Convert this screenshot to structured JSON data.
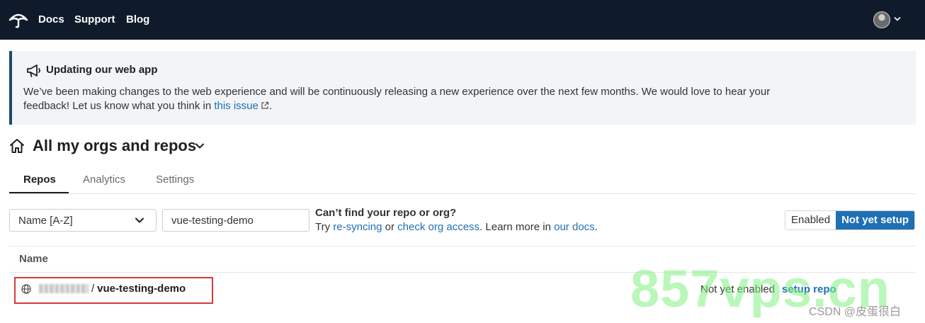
{
  "nav": {
    "links": [
      "Docs",
      "Support",
      "Blog"
    ]
  },
  "banner": {
    "title": "Updating our web app",
    "body_before": "We’ve been making changes to the web experience and will be continuously releasing a new experience over the next few months. We would love to hear your feedback! Let us know what you think in ",
    "link_text": "this issue",
    "body_after": "."
  },
  "page": {
    "title": "All my orgs and repos"
  },
  "tabs": [
    {
      "label": "Repos",
      "active": true
    },
    {
      "label": "Analytics",
      "active": false
    },
    {
      "label": "Settings",
      "active": false
    }
  ],
  "filters": {
    "sort_value": "Name [A-Z]",
    "search_value": "vue-testing-demo",
    "help_title": "Can’t find your repo or org?",
    "help_try": "Try ",
    "help_resync": "re-syncing",
    "help_or": " or ",
    "help_check": "check org access",
    "help_learn": ". Learn more in ",
    "help_docs": "our docs",
    "help_end": "."
  },
  "toggle": {
    "enabled_label": "Enabled",
    "not_setup_label": "Not yet setup",
    "selected": "Not yet setup"
  },
  "table": {
    "column_name": "Name",
    "rows": [
      {
        "slash": "/",
        "repo": "vue-testing-demo",
        "status": "Not yet enabled",
        "action": "setup repo"
      }
    ]
  },
  "watermarks": {
    "big": "857vps.cn",
    "small": "CSDN @皮蛋很白"
  },
  "colors": {
    "nav_bg": "#0f1b2b",
    "accent": "#1f6fb5",
    "banner_border": "#1c4a6b",
    "highlight_box": "#d33b3b"
  },
  "icons": {
    "logo": "umbrella-logo-icon",
    "banner": "megaphone-icon",
    "home": "home-icon",
    "external": "external-link-icon",
    "globe": "globe-icon"
  }
}
